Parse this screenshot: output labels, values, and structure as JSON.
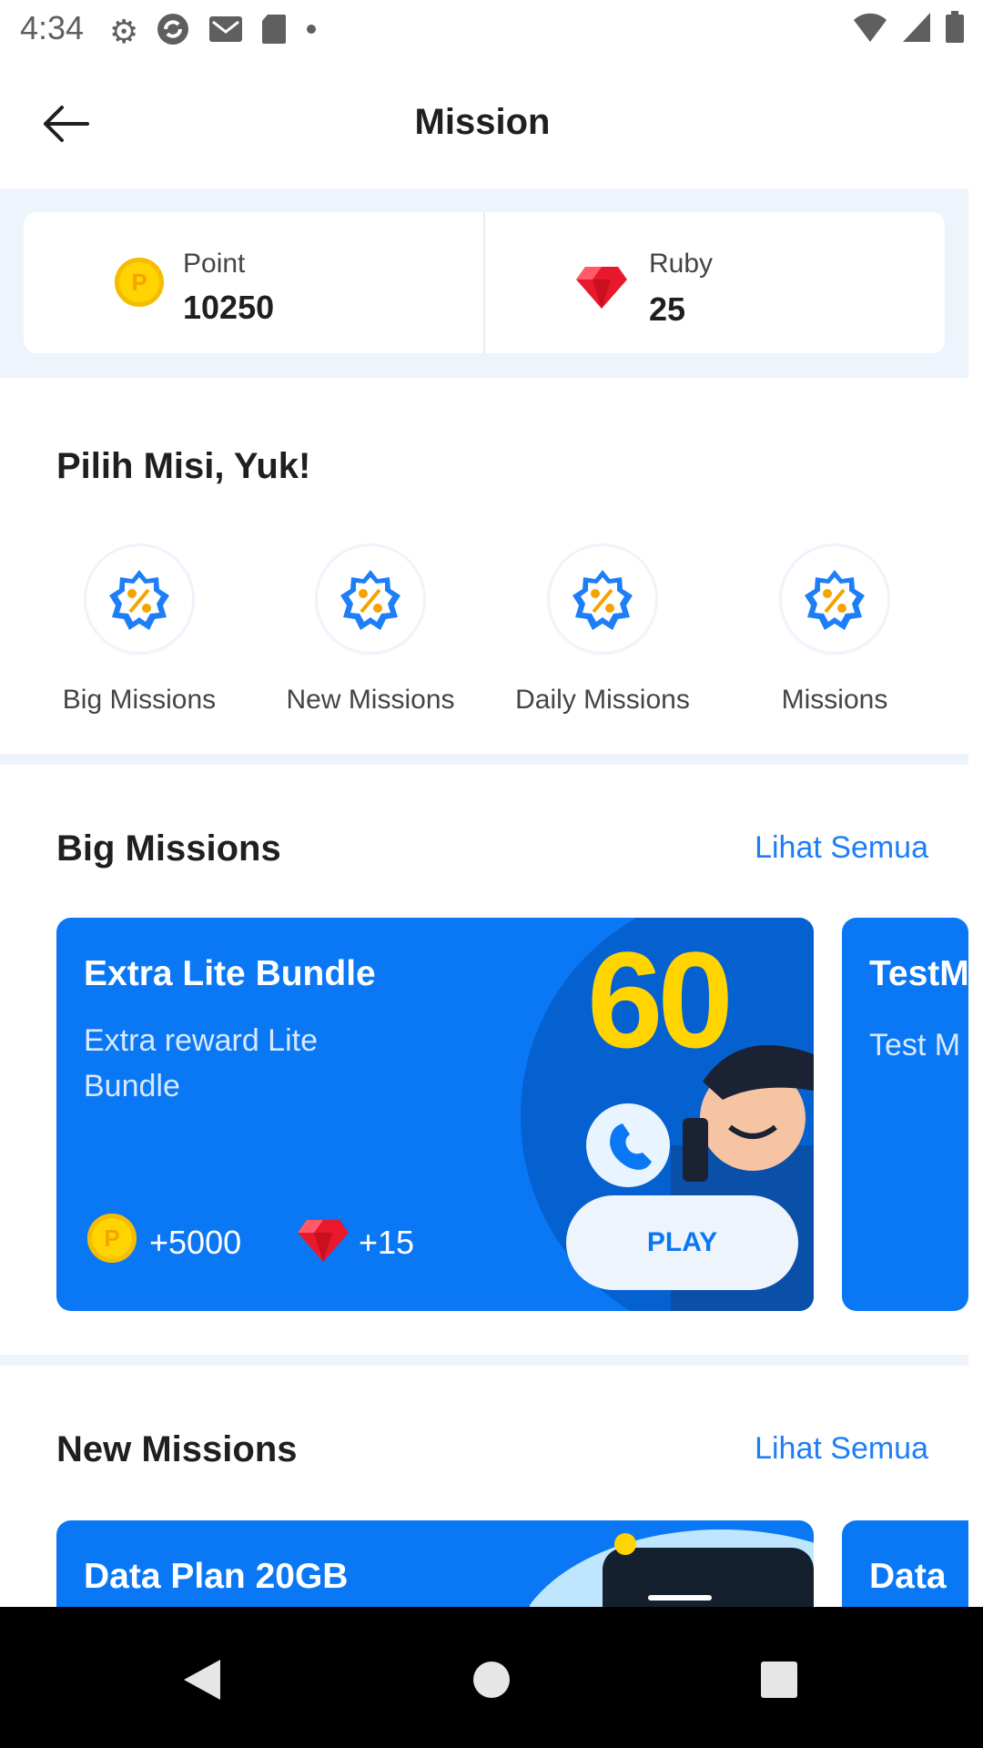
{
  "status_bar": {
    "time": "4:34",
    "left_icons": [
      "gear-icon",
      "sync-icon",
      "mail-icon",
      "sd-card-icon",
      "dot-icon"
    ],
    "right_icons": [
      "wifi-icon",
      "signal-icon",
      "battery-icon"
    ]
  },
  "app_bar": {
    "title": "Mission",
    "back_icon": "arrow-left-icon"
  },
  "balance": {
    "point": {
      "label": "Point",
      "value": "10250",
      "icon": "coin-icon"
    },
    "ruby": {
      "label": "Ruby",
      "value": "25",
      "icon": "ruby-icon"
    }
  },
  "pilih": {
    "title": "Pilih Misi, Yuk!",
    "categories": [
      {
        "label": "Big Missions",
        "icon": "discount-badge-icon"
      },
      {
        "label": "New Missions",
        "icon": "discount-badge-icon"
      },
      {
        "label": "Daily Missions",
        "icon": "discount-badge-icon"
      },
      {
        "label": "Missions",
        "icon": "discount-badge-icon"
      }
    ]
  },
  "big_missions": {
    "title": "Big Missions",
    "see_all": "Lihat Semua",
    "cards": [
      {
        "title": "Extra Lite Bundle",
        "description": "Extra reward Lite Bundle",
        "reward_point": "+5000",
        "reward_ruby": "+15",
        "cta": "PLAY",
        "banner_text": "60"
      },
      {
        "title": "TestM",
        "description": "Test M"
      }
    ]
  },
  "new_missions": {
    "title": "New Missions",
    "see_all": "Lihat Semua",
    "cards": [
      {
        "title": "Data Plan 20GB"
      },
      {
        "title": "Data"
      }
    ]
  },
  "nav_bar": {
    "buttons": [
      "back-triangle-icon",
      "home-circle-icon",
      "recents-square-icon"
    ]
  },
  "colors": {
    "primary": "#0a78f5",
    "link": "#1e7ef7",
    "section_bg": "#eef4fb",
    "coin": "#ffd400",
    "ruby": "#e8192c"
  }
}
